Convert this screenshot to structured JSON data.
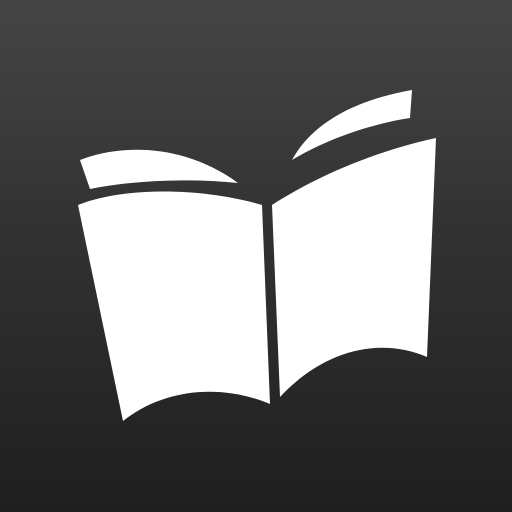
{
  "app_icon": {
    "icon": "open-book-icon",
    "background_colors": [
      "#454546",
      "#323233",
      "#1f1f20"
    ],
    "glyph_color": "#ffffff"
  }
}
